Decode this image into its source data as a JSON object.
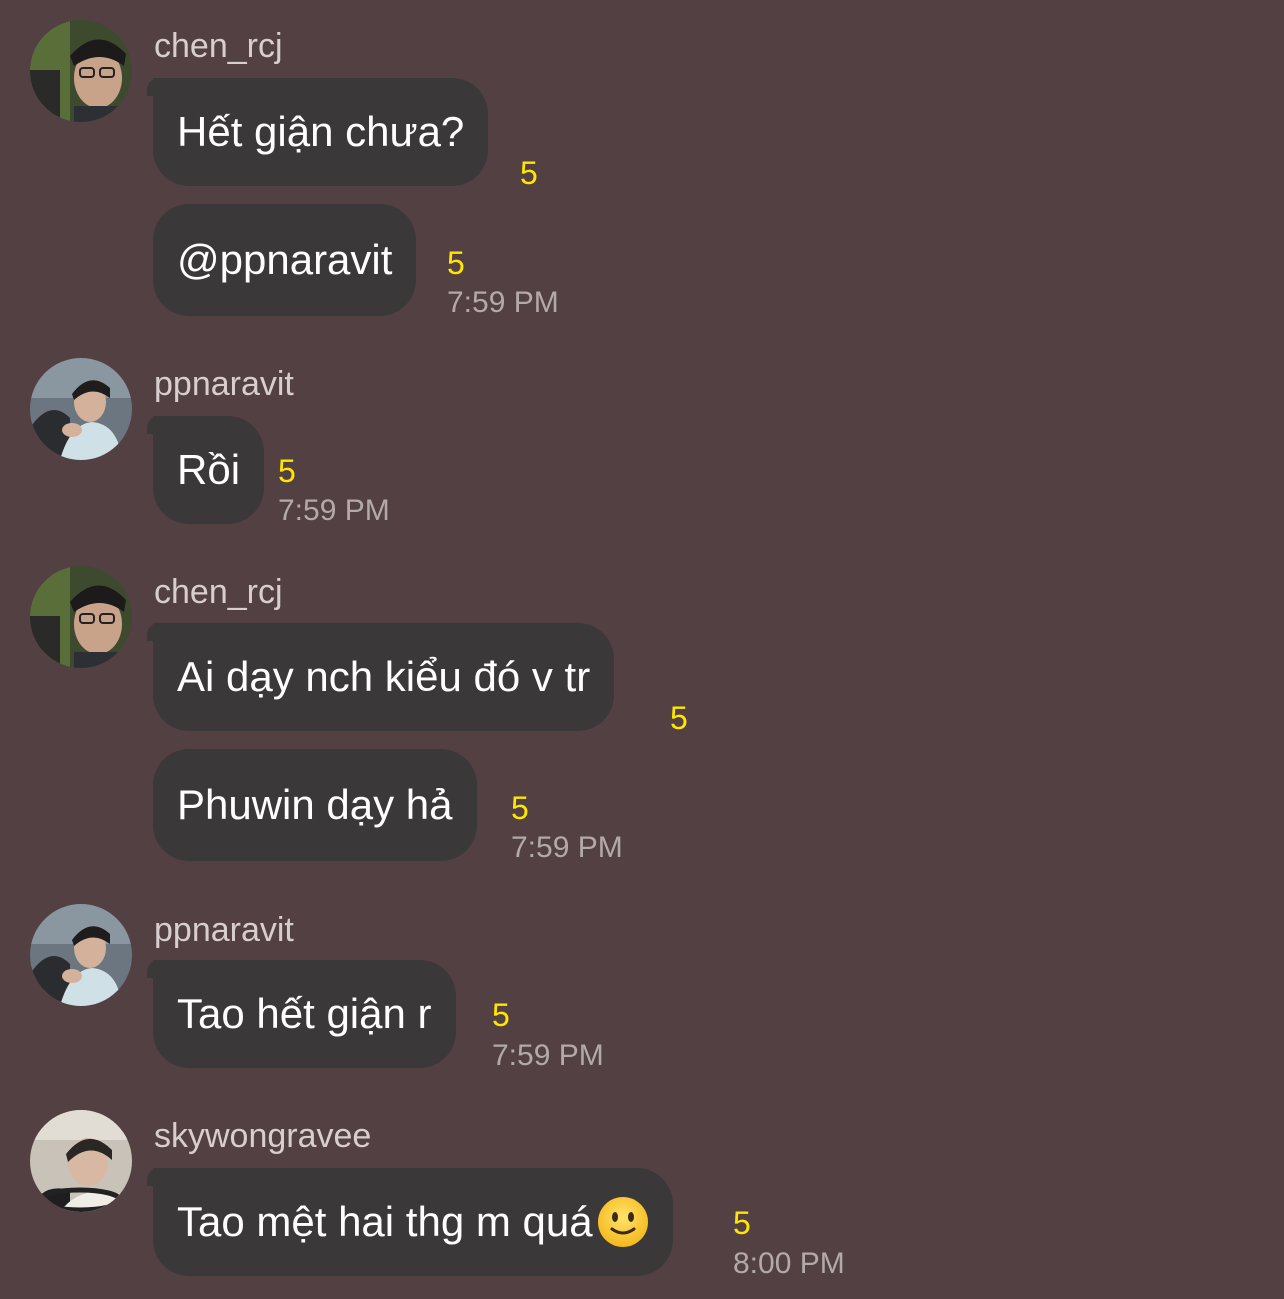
{
  "messages": [
    {
      "sender": "chen_rcj",
      "text": "Hết giận chưa?",
      "count": "5"
    },
    {
      "text": "@ppnaravit",
      "count": "5",
      "time": "7:59 PM"
    },
    {
      "sender": "ppnaravit",
      "text": "Rồi",
      "count": "5",
      "time": "7:59 PM"
    },
    {
      "sender": "chen_rcj",
      "text": "Ai dạy nch kiểu đó v tr",
      "count": "5"
    },
    {
      "text": "Phuwin dạy hả",
      "count": "5",
      "time": "7:59 PM"
    },
    {
      "sender": "ppnaravit",
      "text": "Tao hết giận r",
      "count": "5",
      "time": "7:59 PM"
    },
    {
      "sender": "skywongravee",
      "text": "Tao mệt hai thg m quá",
      "emoji": "slightly-smiling-face-icon",
      "count": "5",
      "time": "8:00 PM"
    }
  ],
  "colors": {
    "background": "#534042",
    "bubble": "#3a3839",
    "count": "#ffe600",
    "timestamp": "#b3a8aa"
  }
}
